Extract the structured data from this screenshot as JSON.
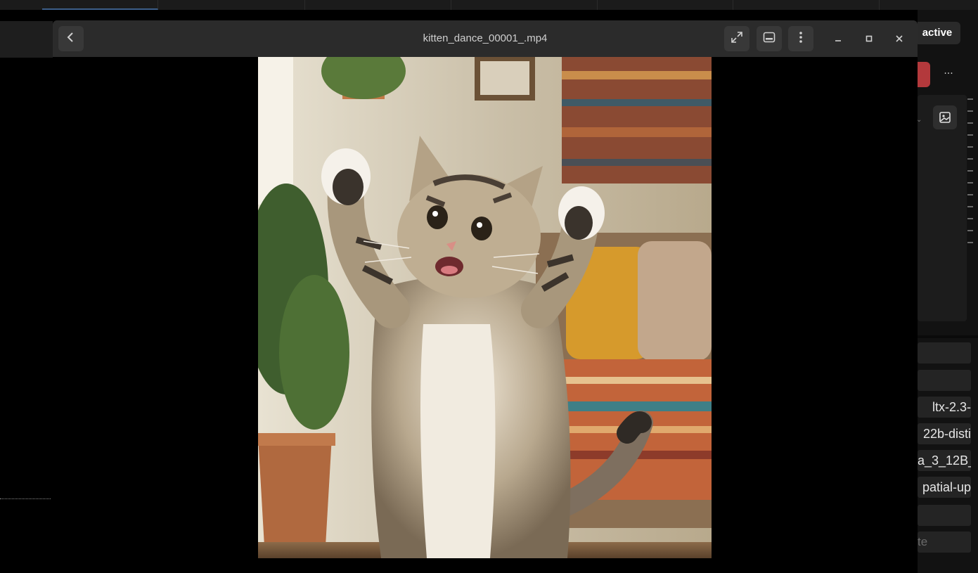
{
  "viewer": {
    "title": "kitten_dance_00001_.mp4",
    "back_icon": "chevron-left-icon",
    "buttons": [
      "fullscreen-icon",
      "picture-in-picture-icon",
      "kebab-menu-icon"
    ],
    "window_controls": [
      "minimize-icon",
      "maximize-icon",
      "close-icon"
    ]
  },
  "background_app": {
    "status_label": "active",
    "more_label": "···",
    "model_rows": [
      "ltx-2.3-",
      "22b-disti",
      "a_3_12B_",
      "patial-up"
    ],
    "bottom_input_text": "te"
  },
  "colors": {
    "titlebar": "#2b2b2b",
    "button_bg": "#383838",
    "danger": "#b3393c",
    "panel": "#121212"
  }
}
